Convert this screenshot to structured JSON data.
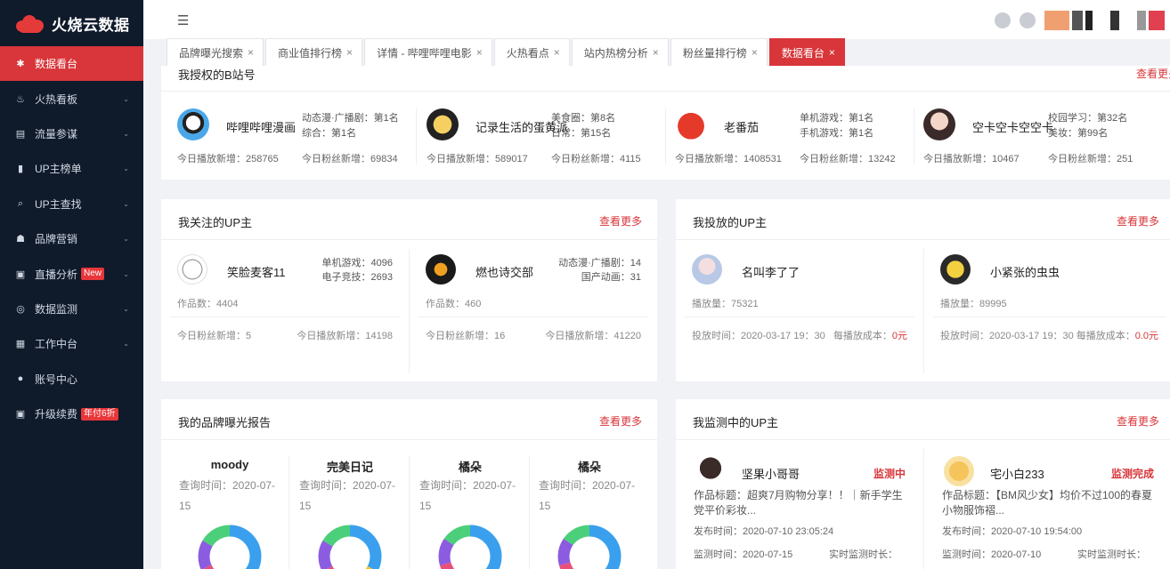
{
  "app": {
    "title": "火烧云数据"
  },
  "sidebar": {
    "items": [
      {
        "label": "数据看台",
        "icon": "gear-icon",
        "active": true
      },
      {
        "label": "火热看板",
        "icon": "flame-icon"
      },
      {
        "label": "流量参谋",
        "icon": "chart-icon"
      },
      {
        "label": "UP主榜单",
        "icon": "bar-icon"
      },
      {
        "label": "UP主查找",
        "icon": "search-icon"
      },
      {
        "label": "品牌营销",
        "icon": "brand-icon"
      },
      {
        "label": "直播分析",
        "icon": "live-icon",
        "badge": "New"
      },
      {
        "label": "数据监测",
        "icon": "monitor-icon"
      },
      {
        "label": "工作中台",
        "icon": "grid-icon"
      },
      {
        "label": "账号中心",
        "icon": "user-icon"
      },
      {
        "label": "升级续费",
        "icon": "upgrade-icon",
        "badge": "年付6折"
      }
    ]
  },
  "tabs": [
    {
      "label": "品牌曝光搜索"
    },
    {
      "label": "商业值排行榜"
    },
    {
      "label": "详情 - 哔哩哔哩电影"
    },
    {
      "label": "火热看点"
    },
    {
      "label": "站内热榜分析"
    },
    {
      "label": "粉丝量排行榜"
    },
    {
      "label": "数据看台",
      "active": true
    }
  ],
  "authorized": {
    "title": "我授权的B站号",
    "more": "查看更多",
    "accounts": [
      {
        "name": "哔哩哔哩漫画",
        "rank1": "动态漫·广播剧：第1名",
        "rank2": "综合：第1名",
        "play": "今日播放新增：258765",
        "fans": "今日粉丝新增：69834"
      },
      {
        "name": "记录生活的蛋黄派",
        "rank1": "美食圈：第8名",
        "rank2": "日常：第15名",
        "play": "今日播放新增：589017",
        "fans": "今日粉丝新增：4115"
      },
      {
        "name": "老番茄",
        "rank1": "单机游戏：第1名",
        "rank2": "手机游戏：第1名",
        "play": "今日播放新增：1408531",
        "fans": "今日粉丝新增：13242"
      },
      {
        "name": "空卡空卡空空卡",
        "rank1": "校园学习：第32名",
        "rank2": "美妆：第99名",
        "play": "今日播放新增：10467",
        "fans": "今日粉丝新增：251"
      }
    ]
  },
  "followed": {
    "title": "我关注的UP主",
    "more": "查看更多",
    "items": [
      {
        "name": "笑脸麦客11",
        "rank1": "单机游戏：4096",
        "rank2": "电子竞技：2693",
        "works": "作品数：4404",
        "fans": "今日粉丝新增：5",
        "play": "今日播放新增：14198"
      },
      {
        "name": "燃也诗交部",
        "rank1": "动态漫·广播剧：14",
        "rank2": "国产动画：31",
        "works": "作品数：460",
        "fans": "今日粉丝新增：16",
        "play": "今日播放新增：41220"
      }
    ]
  },
  "placed": {
    "title": "我投放的UP主",
    "more": "查看更多",
    "items": [
      {
        "name": "名叫李了了",
        "plays": "播放量：75321",
        "time": "投放时间：2020-03-17 19：30",
        "cost_label": "每播放成本：",
        "cost": "0元"
      },
      {
        "name": "小紧张的虫虫",
        "plays": "播放量：89995",
        "time": "投放时间：2020-03-17 19：30",
        "cost_label": "每播放成本：",
        "cost": "0.0元"
      }
    ]
  },
  "brand": {
    "title": "我的品牌曝光报告",
    "more": "查看更多",
    "items": [
      {
        "name": "moody",
        "query": "查询时间：2020-07-15"
      },
      {
        "name": "完美日记",
        "query": "查询时间：2020-07-15"
      },
      {
        "name": "橘朵",
        "query": "查询时间：2020-07-15"
      },
      {
        "name": "橘朵",
        "query": "查询时间：2020-07-15"
      }
    ]
  },
  "monitoring": {
    "title": "我监测中的UP主",
    "more": "查看更多",
    "items": [
      {
        "name": "坚果小哥哥",
        "status": "监测中",
        "work": "作品标题：超爽7月购物分享！！｜新手学生党平价彩妆...",
        "pub": "发布时间：2020-07-10 23:05:24",
        "mon": "监测时间：2020-07-15",
        "rt": "实时监测时长："
      },
      {
        "name": "宅小白233",
        "status": "监测完成",
        "work": "作品标题：【BM风少女】均价不过100的春夏小物服饰褶...",
        "pub": "发布时间：2020-07-10 19:54:00",
        "mon": "监测时间：2020-07-10",
        "rt": "实时监测时长："
      }
    ]
  },
  "colors": {
    "accent": "#d8363a",
    "sidebar": "#0f1a2b"
  }
}
